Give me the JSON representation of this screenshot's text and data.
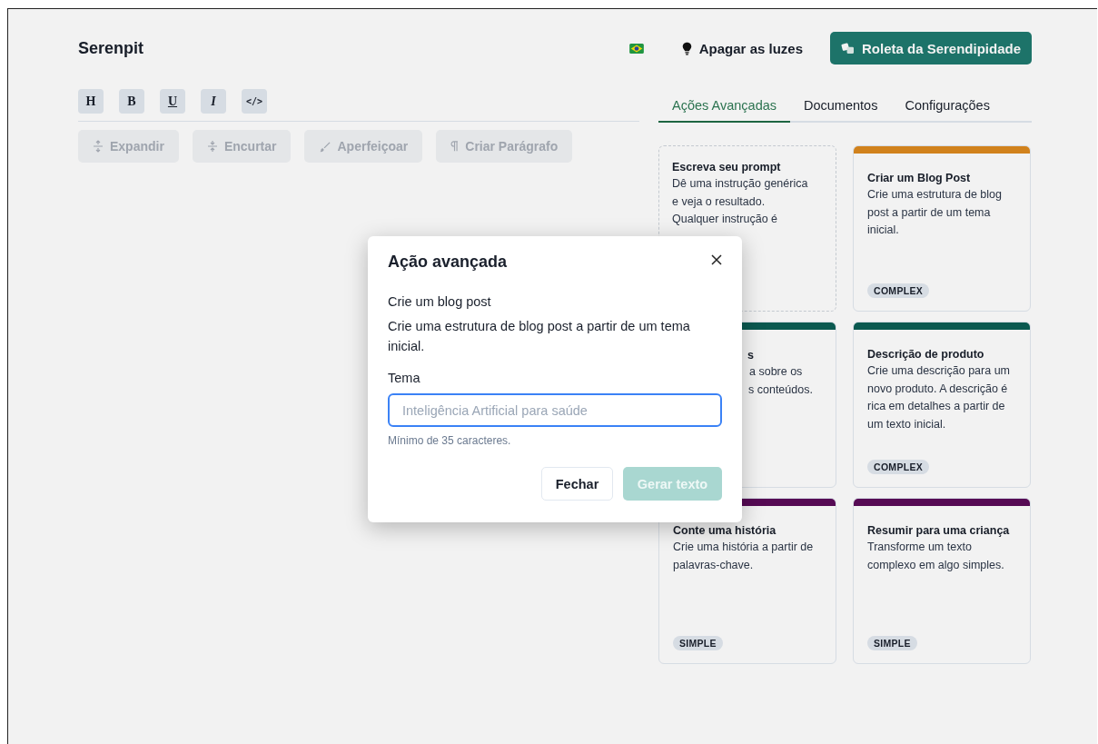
{
  "header": {
    "logo": "Serenpit",
    "lights_button": "Apagar as luzes",
    "roulette_button": "Roleta da Serendipidade"
  },
  "format_toolbar": [
    {
      "label": "H",
      "kind": "heading"
    },
    {
      "label": "B",
      "kind": "bold"
    },
    {
      "label": "U",
      "kind": "underline"
    },
    {
      "label": "I",
      "kind": "italic"
    },
    {
      "label": "</>",
      "kind": "code"
    }
  ],
  "action_buttons": [
    {
      "label": "Expandir",
      "kind": "expand",
      "disabled": true
    },
    {
      "label": "Encurtar",
      "kind": "shorten",
      "disabled": true
    },
    {
      "label": "Aperfeiçoar",
      "kind": "brush",
      "disabled": true
    },
    {
      "label": "Criar Parágrafo",
      "kind": "paragraph",
      "disabled": true
    }
  ],
  "tabs": [
    {
      "label": "Ações Avançadas",
      "selected": true
    },
    {
      "label": "Documentos",
      "selected": false
    },
    {
      "label": "Configurações",
      "selected": false
    }
  ],
  "cards": [
    {
      "kind": "dashed",
      "title": "Escreva seu prompt",
      "description": "Dê uma instrução genérica e veja o resultado. Qualquer instrução é"
    },
    {
      "kind": "bar",
      "color": "#dd8a1f",
      "title": "Criar um Blog Post",
      "description": "Crie uma estrutura de blog post a partir de um tema inicial.",
      "tag": "COMPLEX"
    },
    {
      "kind": "covered",
      "color": "#0c5e55",
      "title": "s",
      "lines": [
        "a sobre os",
        "s conteúdos."
      ]
    },
    {
      "kind": "bar",
      "color": "#0c5e55",
      "title": "Descrição de produto",
      "description": "Crie uma descrição para um novo produto. A descrição é rica em detalhes a partir de um texto inicial.",
      "tag": "COMPLEX"
    },
    {
      "kind": "bar",
      "color": "#5b0b59",
      "title": "Conte uma história",
      "description": "Crie uma história a partir de palavras-chave.",
      "tag": "SIMPLE"
    },
    {
      "kind": "bar",
      "color": "#5b0b59",
      "title": "Resumir para uma criança",
      "description": "Transforme um texto complexo em algo simples.",
      "tag": "SIMPLE"
    }
  ],
  "modal": {
    "title": "Ação avançada",
    "subtitle": "Crie um blog post",
    "description": "Crie uma estrutura de blog post a partir de um tema inicial.",
    "field_label": "Tema",
    "placeholder": "Inteligência Artificial para saúde",
    "help_text": "Mínimo de 35 caracteres.",
    "close_button": "Fechar",
    "submit_button": {
      "label": "Gerar texto",
      "disabled": true
    }
  }
}
